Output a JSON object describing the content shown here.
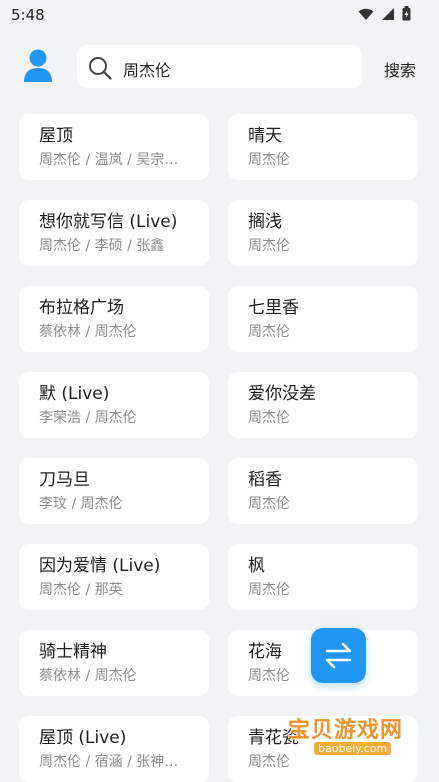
{
  "status_bar": {
    "time": "5:48",
    "icons": [
      "wifi-icon",
      "signal-icon",
      "battery-icon"
    ]
  },
  "header": {
    "avatar_icon": "user-icon",
    "search": {
      "query": "周杰伦",
      "icon": "search-icon"
    },
    "search_button_label": "搜索"
  },
  "songs": [
    {
      "title": "屋顶",
      "artist": "周杰伦 / 温岚 / 吴宗…"
    },
    {
      "title": "晴天",
      "artist": "周杰伦"
    },
    {
      "title": "想你就写信 (Live)",
      "artist": "周杰伦 / 李硕 / 张鑫"
    },
    {
      "title": "搁浅",
      "artist": "周杰伦"
    },
    {
      "title": "布拉格广场",
      "artist": "蔡依林 / 周杰伦"
    },
    {
      "title": "七里香",
      "artist": "周杰伦"
    },
    {
      "title": "默 (Live)",
      "artist": "李荣浩 / 周杰伦"
    },
    {
      "title": "爱你没差",
      "artist": "周杰伦"
    },
    {
      "title": "刀马旦",
      "artist": "李玟 / 周杰伦"
    },
    {
      "title": "稻香",
      "artist": "周杰伦"
    },
    {
      "title": "因为爱情 (Live)",
      "artist": "周杰伦 / 那英"
    },
    {
      "title": "枫",
      "artist": "周杰伦"
    },
    {
      "title": "骑士精神",
      "artist": "蔡依林 / 周杰伦"
    },
    {
      "title": "花海",
      "artist": "周杰伦"
    },
    {
      "title": "屋顶 (Live)",
      "artist": "周杰伦 / 宿涵 / 张神…"
    },
    {
      "title": "青花瓷",
      "artist": "周杰伦"
    }
  ],
  "fab": {
    "icon": "swap-arrows-icon"
  },
  "watermark": {
    "text": "宝贝游戏网",
    "url": "baobeiy.com"
  },
  "colors": {
    "accent": "#2196f3",
    "background": "#f2f3f5",
    "card": "#ffffff",
    "secondary_text": "#8e8e8e"
  }
}
